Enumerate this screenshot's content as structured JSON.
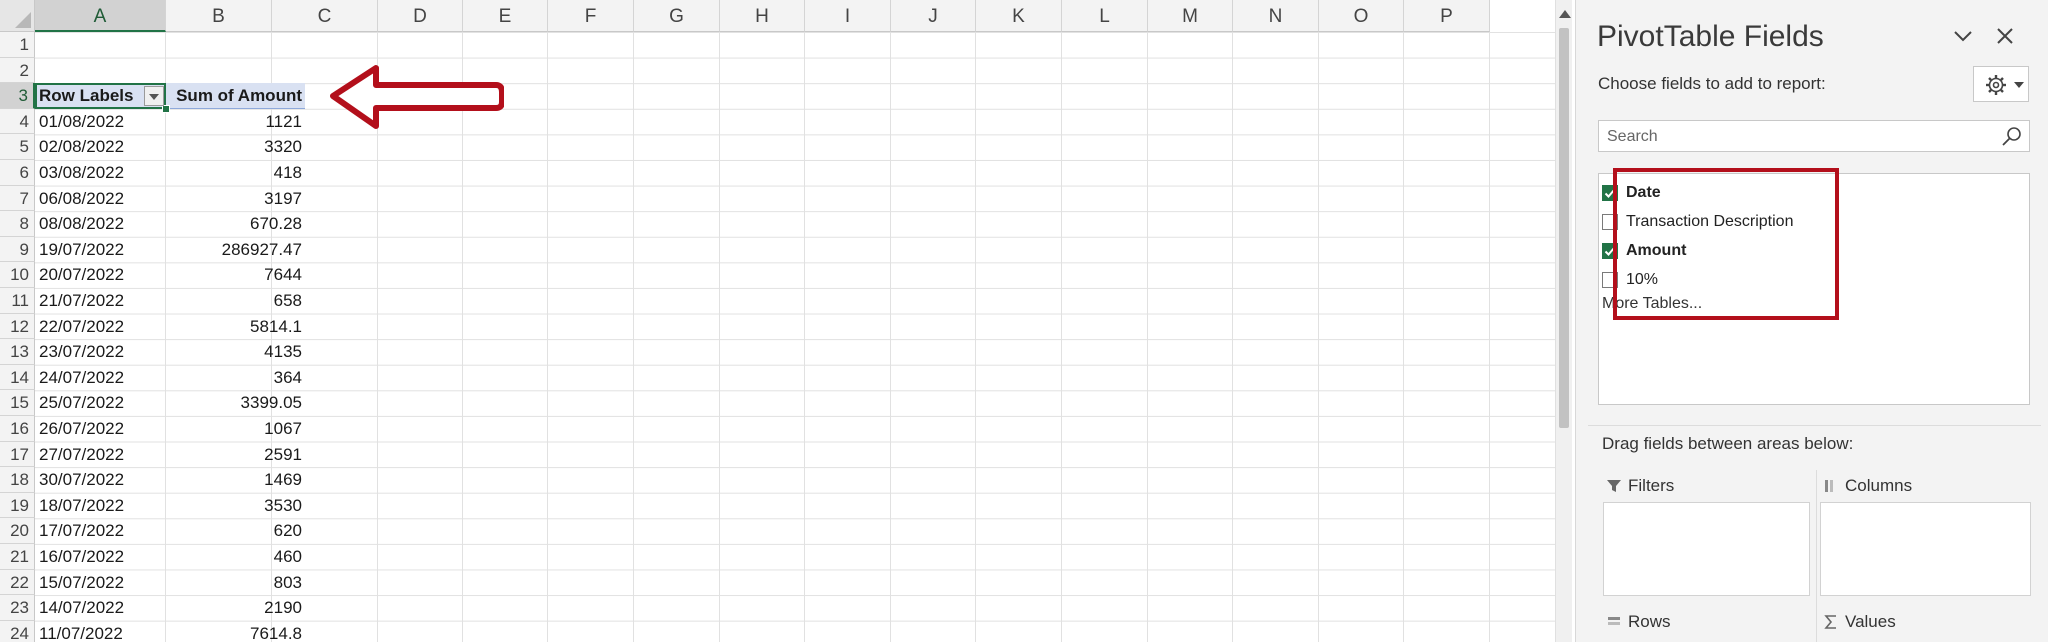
{
  "sheet": {
    "columns": [
      "A",
      "B",
      "C",
      "D",
      "E",
      "F",
      "G",
      "H",
      "I",
      "J",
      "K",
      "L",
      "M",
      "N",
      "O",
      "P"
    ],
    "selected_column": "A",
    "rows": [
      "1",
      "2",
      "3",
      "4",
      "5",
      "6",
      "7",
      "8",
      "9",
      "10",
      "11",
      "12",
      "13",
      "14",
      "15",
      "16",
      "17",
      "18",
      "19",
      "20",
      "21",
      "22",
      "23",
      "24"
    ],
    "selected_row": "3",
    "pivot_header": {
      "row_labels": "Row Labels",
      "sum_label": "Sum of Amount"
    },
    "pivot_rows": [
      {
        "label": "01/08/2022",
        "value": "1121"
      },
      {
        "label": "02/08/2022",
        "value": "3320"
      },
      {
        "label": "03/08/2022",
        "value": "418"
      },
      {
        "label": "06/08/2022",
        "value": "3197"
      },
      {
        "label": "08/08/2022",
        "value": "670.28"
      },
      {
        "label": "19/07/2022",
        "value": "286927.47"
      },
      {
        "label": "20/07/2022",
        "value": "7644"
      },
      {
        "label": "21/07/2022",
        "value": "658"
      },
      {
        "label": "22/07/2022",
        "value": "5814.1"
      },
      {
        "label": "23/07/2022",
        "value": "4135"
      },
      {
        "label": "24/07/2022",
        "value": "364"
      },
      {
        "label": "25/07/2022",
        "value": "3399.05"
      },
      {
        "label": "26/07/2022",
        "value": "1067"
      },
      {
        "label": "27/07/2022",
        "value": "2591"
      },
      {
        "label": "30/07/2022",
        "value": "1469"
      },
      {
        "label": "18/07/2022",
        "value": "3530"
      },
      {
        "label": "17/07/2022",
        "value": "620"
      },
      {
        "label": "16/07/2022",
        "value": "460"
      },
      {
        "label": "15/07/2022",
        "value": "803"
      },
      {
        "label": "14/07/2022",
        "value": "2190"
      },
      {
        "label": "11/07/2022",
        "value": "7614.8"
      }
    ]
  },
  "pane": {
    "title": "PivotTable Fields",
    "choose_label": "Choose fields to add to report:",
    "search_placeholder": "Search",
    "fields": [
      {
        "label": "Date",
        "checked": true
      },
      {
        "label": "Transaction Description",
        "checked": false
      },
      {
        "label": "Amount",
        "checked": true
      },
      {
        "label": "10%",
        "checked": false
      }
    ],
    "more_tables": "More Tables...",
    "drag_label": "Drag fields between areas below:",
    "areas": {
      "filters": "Filters",
      "columns": "Columns",
      "rows": "Rows",
      "values": "Values"
    }
  },
  "colors": {
    "accent": "#217346",
    "highlight": "#b30f1b",
    "pivot_header_bg": "#d9e1f2"
  },
  "icons": [
    "chevron-down-icon",
    "close-icon",
    "gear-icon",
    "search-icon",
    "filter-icon",
    "columns-icon",
    "rows-icon",
    "sigma-icon",
    "arrow-annotation"
  ]
}
